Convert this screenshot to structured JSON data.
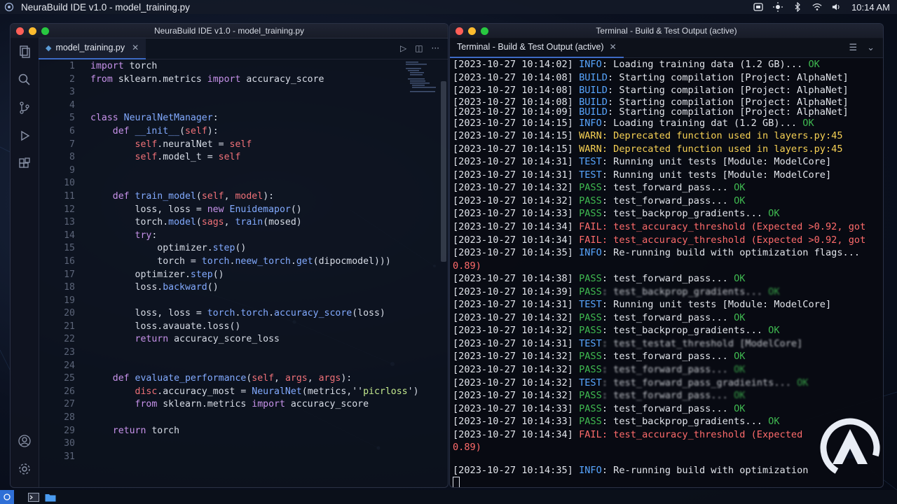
{
  "menubar": {
    "title": "NeuraBuild IDE v1.0 - model_training.py",
    "clock": "10:14 AM"
  },
  "editor_window": {
    "title": "NeuraBuild IDE v1.0 - model_training.py",
    "tab_label": "model_training.py",
    "lines": [
      {
        "n": "1",
        "t": [
          [
            "kw",
            "import"
          ],
          [
            "code",
            " torch"
          ]
        ]
      },
      {
        "n": "2",
        "t": [
          [
            "kw",
            "from"
          ],
          [
            "code",
            " sklearn.metrics "
          ],
          [
            "kw",
            "import"
          ],
          [
            "code",
            " accuracy_score"
          ]
        ]
      },
      {
        "n": "3",
        "t": []
      },
      {
        "n": "4",
        "t": []
      },
      {
        "n": "5",
        "t": [
          [
            "kw",
            "class"
          ],
          [
            "cls",
            " NeuralNetManager"
          ],
          [
            "code",
            ":"
          ]
        ]
      },
      {
        "n": "6",
        "t": [
          [
            "code",
            "    "
          ],
          [
            "kw",
            "def"
          ],
          [
            "fn",
            " __init__"
          ],
          [
            "code",
            "("
          ],
          [
            "slf",
            "self"
          ],
          [
            "code",
            "):"
          ]
        ]
      },
      {
        "n": "7",
        "t": [
          [
            "code",
            "        "
          ],
          [
            "slf",
            "self"
          ],
          [
            "code",
            ".neuralNet = "
          ],
          [
            "slf",
            "self"
          ]
        ]
      },
      {
        "n": "8",
        "t": [
          [
            "code",
            "        "
          ],
          [
            "slf",
            "self"
          ],
          [
            "code",
            ".model_t = "
          ],
          [
            "slf",
            "self"
          ]
        ]
      },
      {
        "n": "9",
        "t": []
      },
      {
        "n": "10",
        "t": []
      },
      {
        "n": "11",
        "t": [
          [
            "code",
            "    "
          ],
          [
            "kw",
            "def"
          ],
          [
            "fn",
            " train_model"
          ],
          [
            "code",
            "("
          ],
          [
            "slf",
            "self"
          ],
          [
            "code",
            ", "
          ],
          [
            "slf",
            "model"
          ],
          [
            "code",
            "):"
          ]
        ]
      },
      {
        "n": "12",
        "t": [
          [
            "code",
            "        loss, loss = "
          ],
          [
            "kw",
            "new"
          ],
          [
            "cls",
            " Enuidemapor"
          ],
          [
            "code",
            "()"
          ]
        ]
      },
      {
        "n": "13",
        "t": [
          [
            "code",
            "        torch."
          ],
          [
            "fn",
            "model"
          ],
          [
            "code",
            "("
          ],
          [
            "slf",
            "sags"
          ],
          [
            "code",
            ", "
          ],
          [
            "fn",
            "train"
          ],
          [
            "code",
            "(mosed)"
          ]
        ]
      },
      {
        "n": "14",
        "t": [
          [
            "code",
            "        "
          ],
          [
            "kw",
            "try"
          ],
          [
            "code",
            ":"
          ]
        ]
      },
      {
        "n": "15",
        "t": [
          [
            "code",
            "            optimizer."
          ],
          [
            "fn",
            "step"
          ],
          [
            "code",
            "()"
          ]
        ]
      },
      {
        "n": "16",
        "t": [
          [
            "code",
            "            torch = "
          ],
          [
            "fn",
            "torch"
          ],
          [
            "code",
            "."
          ],
          [
            "fn",
            "neew_torch"
          ],
          [
            "code",
            "."
          ],
          [
            "fn",
            "get"
          ],
          [
            "code",
            "(dipocmodel)))"
          ]
        ]
      },
      {
        "n": "17",
        "t": [
          [
            "code",
            "        optimizer."
          ],
          [
            "fn",
            "step"
          ],
          [
            "code",
            "()"
          ]
        ]
      },
      {
        "n": "18",
        "t": [
          [
            "code",
            "        loss."
          ],
          [
            "fn",
            "backward"
          ],
          [
            "code",
            "()"
          ]
        ]
      },
      {
        "n": "19",
        "t": []
      },
      {
        "n": "20",
        "t": [
          [
            "code",
            "        loss, loss = "
          ],
          [
            "fn",
            "torch"
          ],
          [
            "code",
            "."
          ],
          [
            "fn",
            "torch"
          ],
          [
            "code",
            "."
          ],
          [
            "fn",
            "accuracy_score"
          ],
          [
            "code",
            "(loss)"
          ]
        ]
      },
      {
        "n": "21",
        "t": [
          [
            "code",
            "        loss.avauate.loss()"
          ]
        ]
      },
      {
        "n": "22",
        "t": [
          [
            "code",
            "        "
          ],
          [
            "kw",
            "return"
          ],
          [
            "code",
            " accuracy_score_loss"
          ]
        ]
      },
      {
        "n": "23",
        "t": []
      },
      {
        "n": "24",
        "t": []
      },
      {
        "n": "25",
        "t": [
          [
            "code",
            "    "
          ],
          [
            "kw",
            "def"
          ],
          [
            "fn",
            " evaluate_performance"
          ],
          [
            "code",
            "("
          ],
          [
            "slf",
            "self"
          ],
          [
            "code",
            ", "
          ],
          [
            "slf",
            "args"
          ],
          [
            "code",
            ", "
          ],
          [
            "slf",
            "args"
          ],
          [
            "code",
            "):"
          ]
        ]
      },
      {
        "n": "26",
        "t": [
          [
            "code",
            "        "
          ],
          [
            "slf",
            "disc"
          ],
          [
            "code",
            ".accuracy_most = "
          ],
          [
            "cls",
            "NeuralNet"
          ],
          [
            "code",
            "(metrics,''"
          ],
          [
            "str",
            "picrloss"
          ],
          [
            "code",
            "')"
          ]
        ]
      },
      {
        "n": "27",
        "t": [
          [
            "code",
            "        "
          ],
          [
            "kw",
            "from"
          ],
          [
            "code",
            " sklearn.metrics "
          ],
          [
            "kw",
            "import"
          ],
          [
            "code",
            " accuracy_score"
          ]
        ]
      },
      {
        "n": "28",
        "t": []
      },
      {
        "n": "29",
        "t": [
          [
            "code",
            "    "
          ],
          [
            "kw",
            "return"
          ],
          [
            "code",
            " torch"
          ]
        ]
      },
      {
        "n": "30",
        "t": []
      },
      {
        "n": "31",
        "t": []
      }
    ]
  },
  "terminal_window": {
    "title": "Terminal - Build & Test Output (active)",
    "tab_label": "Terminal - Build & Test Output (active)",
    "lines": [
      {
        "ts": "[2023-10-27 10:14:02] ",
        "k": "INFO",
        "kc": "k-info",
        "msg": ": Loading training data (1.2 GB)... ",
        "ok": "OK"
      },
      {
        "ts": "[2023-10-27 10:14:08] ",
        "k": "BUILD",
        "kc": "k-build",
        "msg": ": Starting compilation [Project: AlphaNet]",
        "ok": ""
      },
      {
        "ts": "[2023-10-27 10:14:08] ",
        "k": "BUILD",
        "kc": "k-build",
        "msg": ": Starting compilation [Project: AlphaNet]",
        "ok": ""
      },
      {
        "ts": "[2023-10-27 10:14:08] ",
        "k": "BUILD",
        "kc": "k-build",
        "msg": ": Starting compilation [Project: AlphaNet]",
        "ok": "",
        "tight": true
      },
      {
        "ts": "[2023-10-27 10:14:09] ",
        "k": "BUILD",
        "kc": "k-build",
        "msg": ": Starting compilation [Project: AlphaNet]",
        "ok": "",
        "tight": true
      },
      {
        "ts": "[2023-10-27 10:14:15] ",
        "k": "INFO",
        "kc": "k-info",
        "msg": ": Loading training dat (1.2 GB)... ",
        "ok": "OK"
      },
      {
        "ts": "[2023-10-27 10:14:15] ",
        "k": "WARN",
        "kc": "k-warn",
        "msg": ": Deprecated function used in layers.py:45",
        "ok": "",
        "msgc": "k-warn"
      },
      {
        "ts": "[2023-10-27 10:14:15] ",
        "k": "WARN",
        "kc": "k-warn",
        "msg": ": Deprecated function used in layers.py:45",
        "ok": "",
        "msgc": "k-warn"
      },
      {
        "ts": "[2023-10-27 10:14:31] ",
        "k": "TEST",
        "kc": "k-test",
        "msg": ": Running unit tests [Module: ModelCore]",
        "ok": ""
      },
      {
        "ts": "[2023-10-27 10:14:31] ",
        "k": "TEST",
        "kc": "k-test",
        "msg": ": Running unit tests [Module: ModelCore]",
        "ok": ""
      },
      {
        "ts": "[2023-10-27 10:14:32] ",
        "k": "PASS",
        "kc": "k-pass",
        "msg": ": test_forward_pass... ",
        "ok": "OK"
      },
      {
        "ts": "[2023-10-27 10:14:32] ",
        "k": "PASS",
        "kc": "k-pass",
        "msg": ": test_forward_pass... ",
        "ok": "OK"
      },
      {
        "ts": "[2023-10-27 10:14:33] ",
        "k": "PASS",
        "kc": "k-pass",
        "msg": ": test_backprop_gradients... ",
        "ok": "OK"
      },
      {
        "ts": "[2023-10-27 10:14:34] ",
        "k": "FAIL",
        "kc": "k-fail",
        "msg": ": test_accuracy_threshold (Expected >0.92, got",
        "ok": "",
        "msgc": "k-fail"
      },
      {
        "ts": "[2023-10-27 10:14:34] ",
        "k": "FAIL",
        "kc": "k-fail",
        "msg": ": test_accuracy_threshold (Expected >0.92, got",
        "ok": "",
        "msgc": "k-fail"
      },
      {
        "ts": "[2023-10-27 10:14:35] ",
        "k": "INFO",
        "kc": "k-info",
        "msg": ": Re-running build with optimization flags...",
        "ok": ""
      },
      {
        "ts": "",
        "k": "",
        "kc": "",
        "msg": "0.89)",
        "ok": "",
        "msgc": "k-fail",
        "raw": true
      },
      {
        "ts": "[2023-10-27 10:14:38] ",
        "k": "PASS",
        "kc": "k-pass",
        "msg": ": test_forward_pass... ",
        "ok": "OK"
      },
      {
        "ts": "[2023-10-27 10:14:39] ",
        "k": "PASS",
        "kc": "k-pass",
        "msg": ": test_backprop_gradients... ",
        "ok": "OK",
        "blur": true
      },
      {
        "ts": "[2023-10-27 10:14:31] ",
        "k": "TEST",
        "kc": "k-test",
        "msg": ": Running unit tests [Module: ModelCore]",
        "ok": ""
      },
      {
        "ts": "[2023-10-27 10:14:32] ",
        "k": "PASS",
        "kc": "k-pass",
        "msg": ": test_forward_pass... ",
        "ok": "OK"
      },
      {
        "ts": "[2023-10-27 10:14:32] ",
        "k": "PASS",
        "kc": "k-pass",
        "msg": ": test_backprop_gradients... ",
        "ok": "OK"
      },
      {
        "ts": "[2023-10-27 10:14:31] ",
        "k": "TEST",
        "kc": "k-test",
        "msg": ": test_testat_threshold [ModelCore]",
        "ok": "",
        "blur": true
      },
      {
        "ts": "[2023-10-27 10:14:32] ",
        "k": "PASS",
        "kc": "k-pass",
        "msg": ": test_forward_pass... ",
        "ok": "OK"
      },
      {
        "ts": "[2023-10-27 10:14:32] ",
        "k": "PASS",
        "kc": "k-pass",
        "msg": ": test_forward_pass... ",
        "ok": "OK",
        "blur": true
      },
      {
        "ts": "[2023-10-27 10:14:32] ",
        "k": "TEST",
        "kc": "k-test",
        "msg": ": test_forward_pass_gradieints... ",
        "ok": "OK",
        "blur": true
      },
      {
        "ts": "[2023-10-27 10:14:32] ",
        "k": "PASS",
        "kc": "k-pass",
        "msg": ": test_forward_pass... ",
        "ok": "OK",
        "blur": true
      },
      {
        "ts": "[2023-10-27 10:14:33] ",
        "k": "PASS",
        "kc": "k-pass",
        "msg": ": test_forward_pass... ",
        "ok": "OK"
      },
      {
        "ts": "[2023-10-27 10:14:33] ",
        "k": "PASS",
        "kc": "k-pass",
        "msg": ": test_backprop_gradients... ",
        "ok": "OK"
      },
      {
        "ts": "[2023-10-27 10:14:34] ",
        "k": "FAIL",
        "kc": "k-fail",
        "msg": ": test_accuracy_threshold (Expected",
        "ok": "",
        "msgc": "k-fail"
      },
      {
        "ts": "",
        "k": "",
        "kc": "",
        "msg": "0.89)",
        "ok": "",
        "msgc": "k-fail",
        "raw": true
      },
      {
        "ts": "",
        "k": "",
        "kc": "",
        "msg": "",
        "ok": "",
        "raw": true,
        "tight": true
      },
      {
        "ts": "[2023-10-27 10:14:35] ",
        "k": "INFO",
        "kc": "k-info",
        "msg": ": Re-running build with optimization",
        "ok": ""
      }
    ]
  },
  "colors": {
    "accent": "#3d6ac4",
    "pass": "#3fb950",
    "fail": "#ff6b6b",
    "warn": "#f7d154",
    "info": "#58a6ff"
  }
}
